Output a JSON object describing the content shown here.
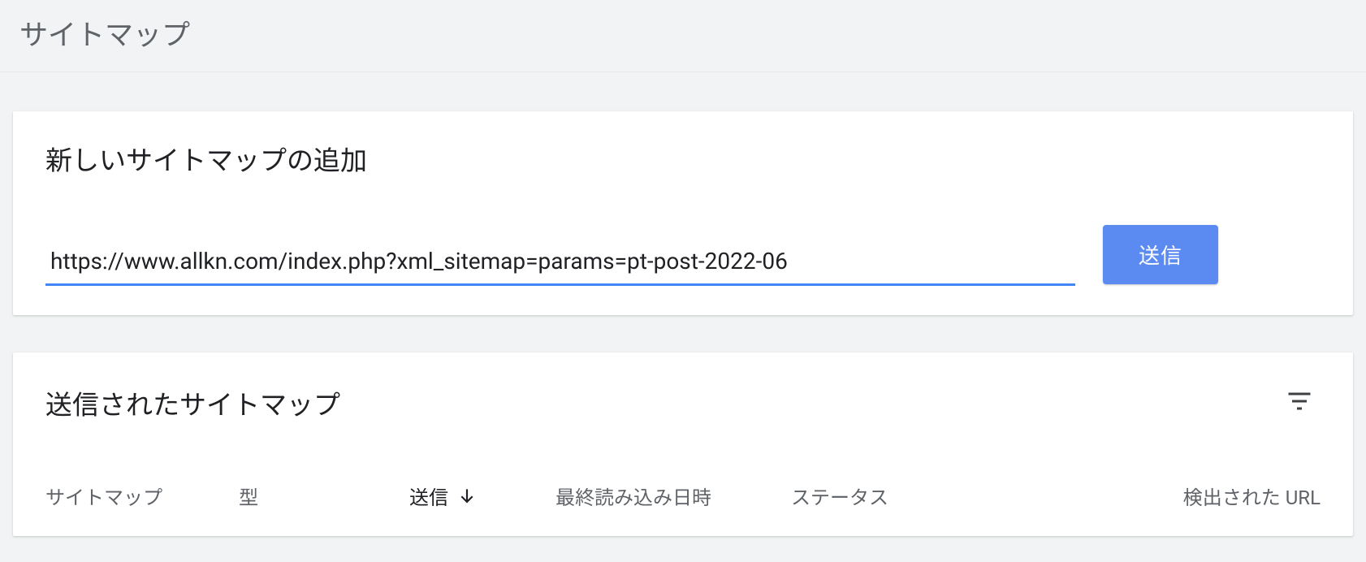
{
  "page": {
    "title": "サイトマップ"
  },
  "add_card": {
    "title": "新しいサイトマップの追加",
    "input_value": "https://www.allkn.com/index.php?xml_sitemap=params=pt-post-2022-06",
    "submit_label": "送信"
  },
  "list_card": {
    "title": "送信されたサイトマップ",
    "columns": {
      "sitemap": "サイトマップ",
      "type": "型",
      "sent": "送信",
      "last_read": "最終読み込み日時",
      "status": "ステータス",
      "discovered_urls": "検出された URL"
    }
  }
}
